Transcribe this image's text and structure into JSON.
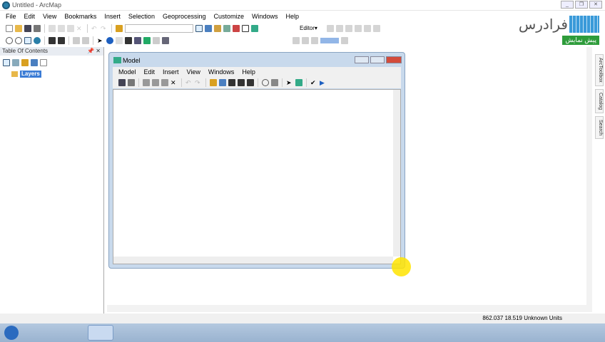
{
  "window": {
    "title": "Untitled - ArcMap"
  },
  "menu": [
    "File",
    "Edit",
    "View",
    "Bookmarks",
    "Insert",
    "Selection",
    "Geoprocessing",
    "Customize",
    "Windows",
    "Help"
  ],
  "editor_label": "Editor▾",
  "toc": {
    "title": "Table Of Contents",
    "root_layer": "Layers"
  },
  "model": {
    "title": "Model",
    "menu": [
      "Model",
      "Edit",
      "Insert",
      "View",
      "Windows",
      "Help"
    ]
  },
  "dock_tabs": [
    "ArcToolbox",
    "Catalog",
    "Search"
  ],
  "status": {
    "coords": "862.037  18.519 Unknown Units"
  },
  "watermark": {
    "brand": "فرادرس",
    "badge": "پیش نمایش"
  },
  "colors": {
    "accent": "#3a7bd5",
    "badge": "#2e9c3b"
  }
}
